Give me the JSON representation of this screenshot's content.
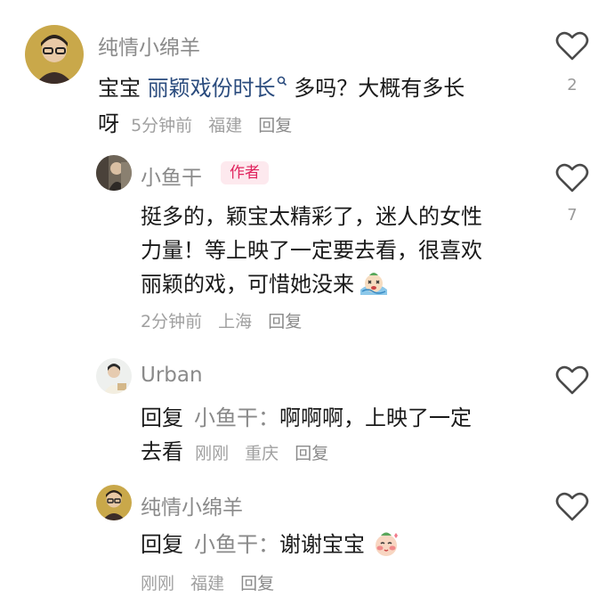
{
  "comments": [
    {
      "username": "纯情小绵羊",
      "text_prefix": "宝宝 ",
      "text_link": "丽颖戏份时长",
      "text_line1_suffix": " 多吗？大概有多长",
      "text_line2": "呀",
      "time": "5分钟前",
      "location": "福建",
      "reply_label": "回复",
      "likes": "2"
    },
    {
      "username": "小鱼干",
      "badge": "作者",
      "lines": [
        "挺多的，颖宝太精彩了，迷人的女性",
        "力量！等上映了一定要去看，很喜欢",
        "丽颖的戏，可惜她没来"
      ],
      "time": "2分钟前",
      "location": "上海",
      "reply_label": "回复",
      "likes": "7"
    },
    {
      "username": "Urban",
      "reply_prefix": "回复",
      "mention": "小鱼干：",
      "line1": "啊啊啊，上映了一定",
      "line2": "去看",
      "time": "刚刚",
      "location": "重庆",
      "reply_label": "回复"
    },
    {
      "username": "纯情小绵羊",
      "reply_prefix": "回复",
      "mention": "小鱼干：",
      "line1": "谢谢宝宝",
      "time": "刚刚",
      "location": "福建",
      "reply_label": "回复"
    }
  ],
  "icons": {
    "heart": "heart-outline-icon",
    "search": "search-small-icon",
    "emoji1": "crying-emoji-icon",
    "emoji2": "blushing-emoji-icon"
  },
  "colors": {
    "badge_bg": "#fde9ee",
    "badge_text": "#e0245e",
    "link": "#2b4c7e"
  }
}
